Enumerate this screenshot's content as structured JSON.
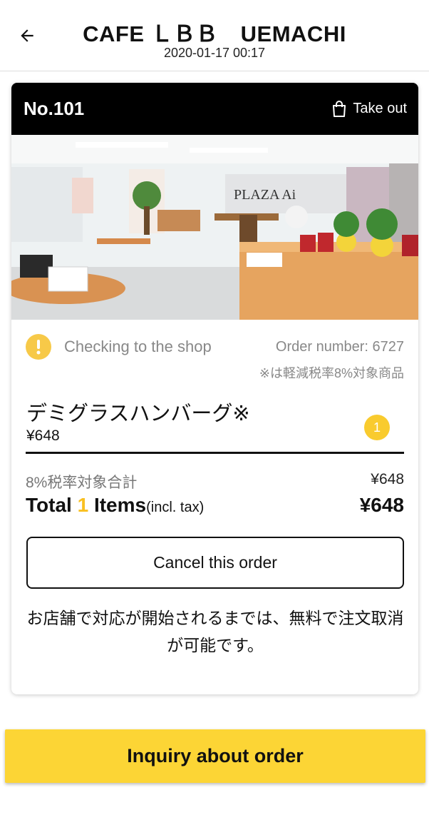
{
  "header": {
    "title": "CAFE ＬＢＢ　UEMACHI",
    "datetime": "2020-01-17 00:17",
    "back_icon": "arrow-left-icon"
  },
  "order_card": {
    "table_number": "No.101",
    "order_type": "Take out",
    "order_type_icon": "shopping-bag-icon",
    "photo_sign": "PLAZA Ai",
    "status": {
      "icon": "exclamation-circle-icon",
      "text": "Checking to the shop",
      "order_number": "Order number: 6727",
      "tax_note": "※は軽減税率8%対象商品"
    },
    "item": {
      "name": "デミグラスハンバーグ※",
      "price": "¥648",
      "quantity": "1"
    },
    "totals": {
      "reduced_tax_label": "8%税率対象合計",
      "reduced_tax_value": "¥648",
      "total_prefix": "Total",
      "total_count": "1",
      "total_items": "Items",
      "total_incl": "(incl. tax)",
      "total_value": "¥648"
    },
    "cancel_button": "Cancel this order",
    "cancel_note": "お店舗で対応が開始されるまでは、無料で注文取消が可能です。"
  },
  "inquiry_button": "Inquiry about order",
  "colors": {
    "accent_yellow": "#fcd535",
    "status_yellow": "#f7c948",
    "header_black": "#000000"
  }
}
